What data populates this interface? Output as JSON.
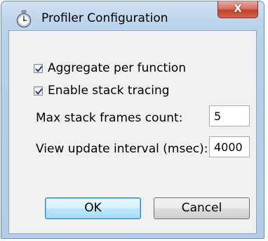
{
  "window": {
    "title": "Profiler Configuration",
    "close_label": "X"
  },
  "options": {
    "aggregate_label": "Aggregate per function",
    "aggregate_checked": true,
    "stack_tracing_label": "Enable stack tracing",
    "stack_tracing_checked": true
  },
  "fields": {
    "max_stack_frames_label": "Max stack frames count:",
    "max_stack_frames_value": "5",
    "view_update_interval_label": "View update interval (msec):",
    "view_update_interval_value": "4000"
  },
  "buttons": {
    "ok_label": "OK",
    "cancel_label": "Cancel"
  },
  "colors": {
    "title_bar": "#bcd4ec",
    "close_button": "#c2402b",
    "dialog_body": "#f0f0f0",
    "default_button": "#bee6fd"
  }
}
